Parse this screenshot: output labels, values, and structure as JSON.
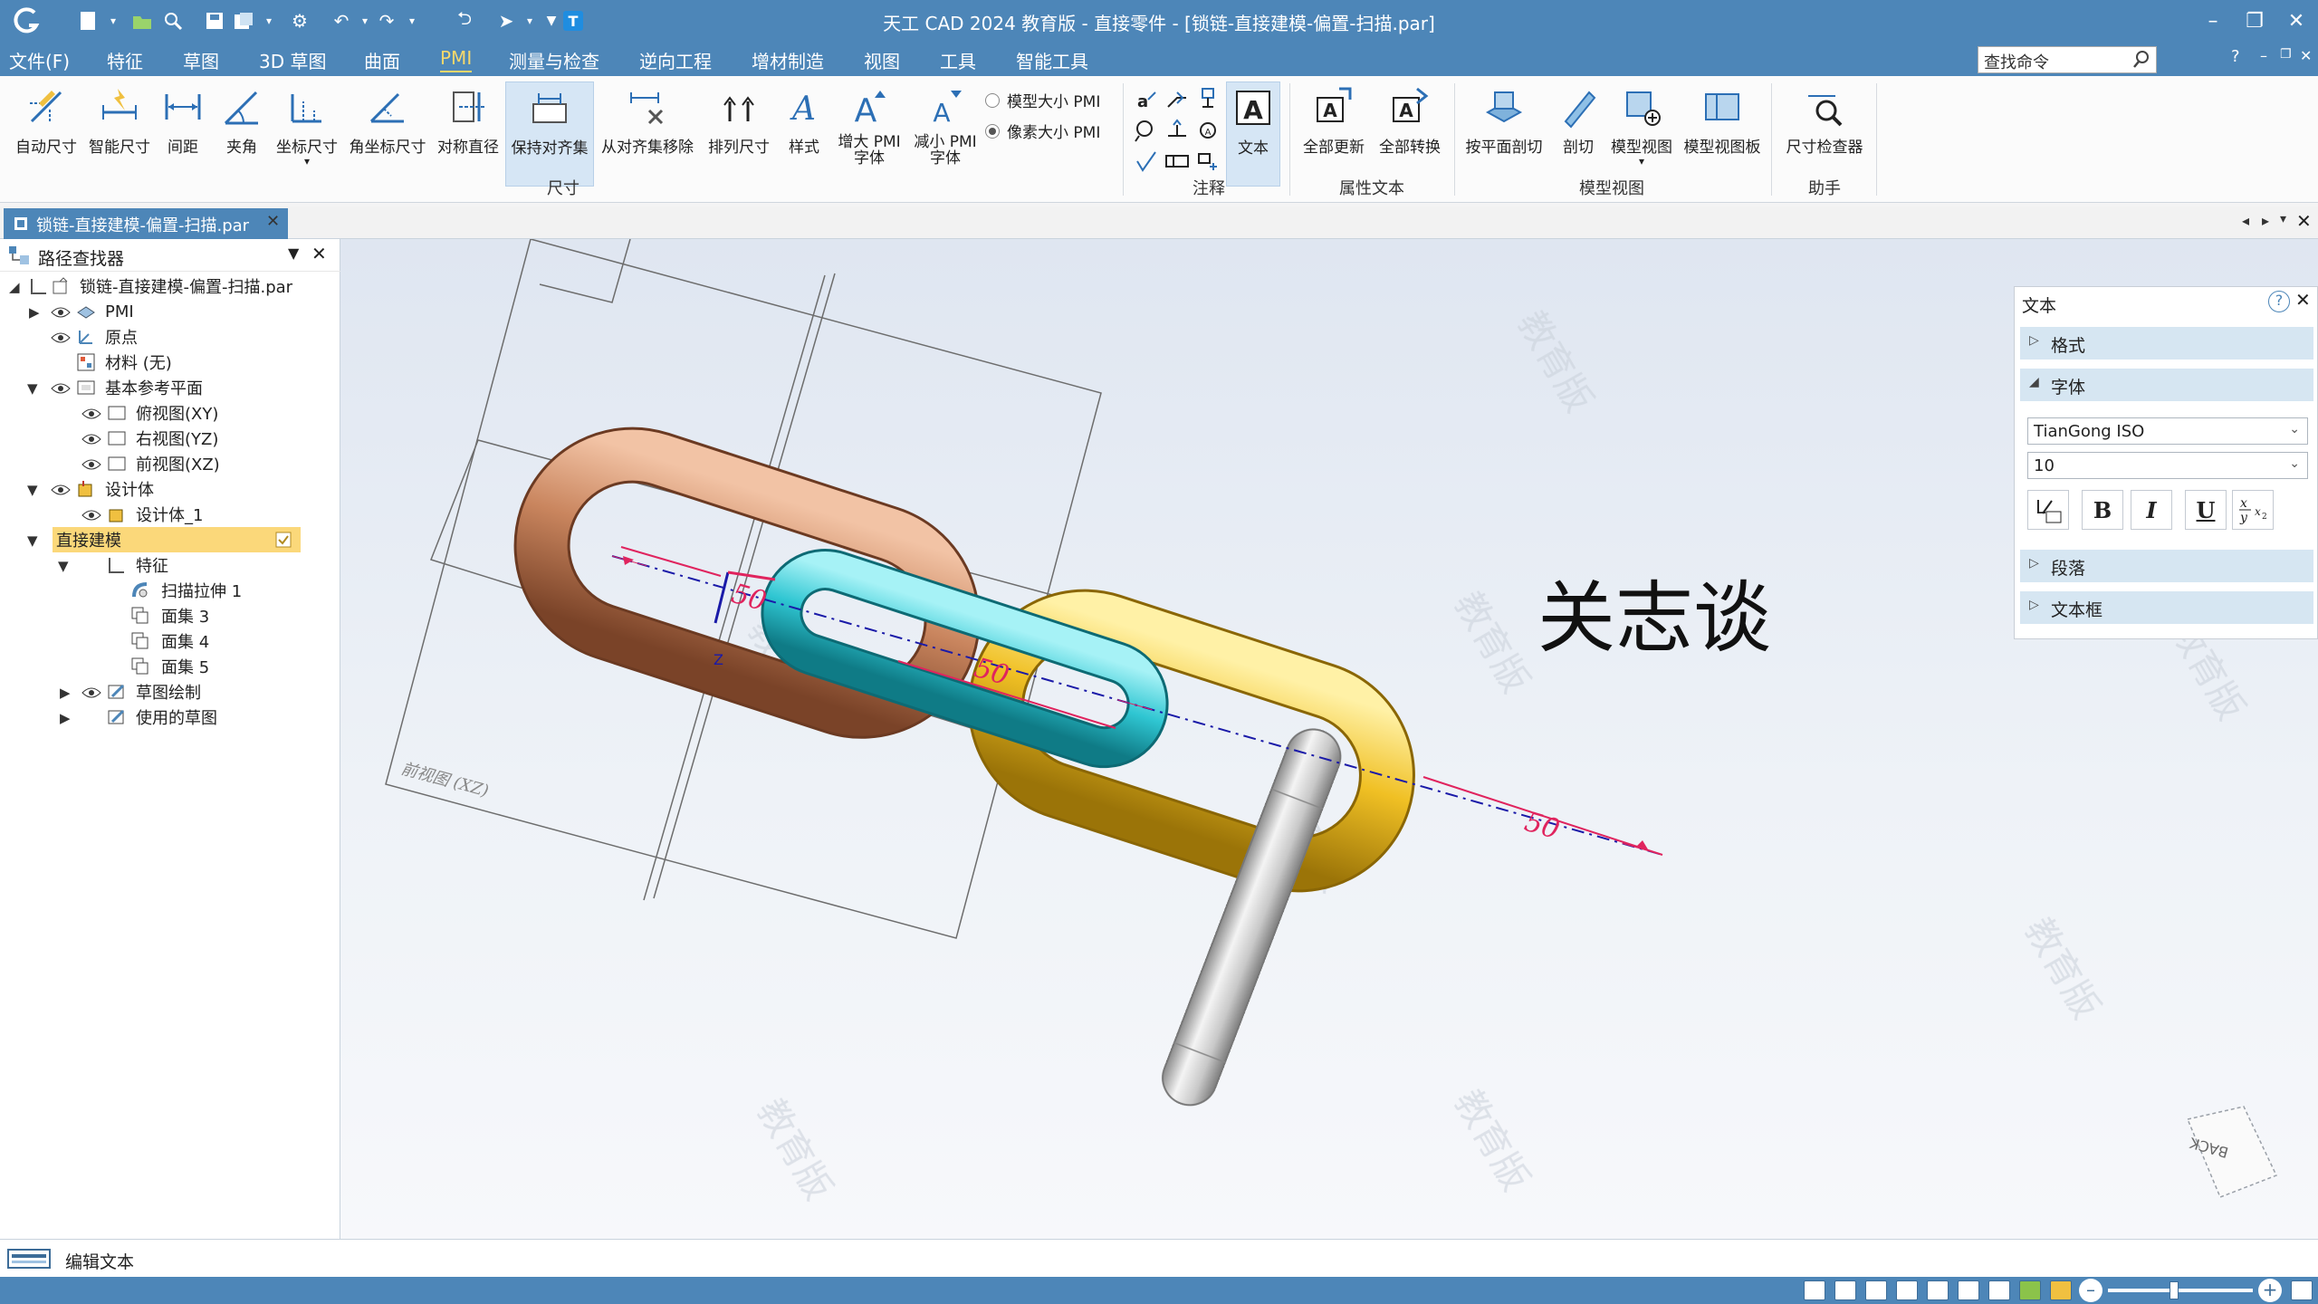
{
  "app": {
    "title": "天工 CAD 2024 教育版 - 直接零件 - [锁链-直接建模-偏置-扫描.par]"
  },
  "menu": [
    "文件(F)",
    "特征",
    "草图",
    "3D 草图",
    "曲面",
    "PMI",
    "测量与检查",
    "逆向工程",
    "增材制造",
    "视图",
    "工具",
    "智能工具"
  ],
  "search": {
    "value": "查找命令"
  },
  "help": {
    "label": "?"
  },
  "ribbon": {
    "dimension": [
      "自动尺寸",
      "智能尺寸",
      "间距",
      "夹角",
      "坐标尺寸",
      "角坐标尺寸",
      "对称直径",
      "保持对齐集",
      "从对齐集移除",
      "排列尺寸",
      "样式"
    ],
    "pmi_font_up": [
      "增大 PMI",
      "字体"
    ],
    "pmi_font_down": [
      "减小 PMI",
      "字体"
    ],
    "model_size": "模型大小 PMI",
    "pixel_size": "像素大小 PMI",
    "text_btn": "文本",
    "attr": [
      "全部更新",
      "全部转换"
    ],
    "model_view": [
      "按平面剖切",
      "剖切",
      "模型视图",
      "模型视图板"
    ],
    "helper": [
      "尺寸检查器"
    ],
    "groups": {
      "dimension": "尺寸",
      "annotation": "注释",
      "attr_text": "属性文本",
      "model_view": "模型视图",
      "helper": "助手"
    }
  },
  "tab": {
    "label": "锁链-直接建模-偏置-扫描.par"
  },
  "tree": {
    "header": "路径查找器",
    "root": "锁链-直接建模-偏置-扫描.par",
    "nodes": [
      "PMI",
      "原点",
      "材料 (无)",
      "基本参考平面",
      "俯视图(XY)",
      "右视图(YZ)",
      "前视图(XZ)",
      "设计体",
      "设计体_1",
      "直接建模",
      "特征",
      "扫描拉伸 1",
      "面集 3",
      "面集 4",
      "面集 5",
      "草图绘制",
      "使用的草图"
    ]
  },
  "viewport": {
    "big_text": "关志谈",
    "dimension": "50",
    "plane_label": "前视图 (XZ)",
    "watermark": "教育版",
    "axis_z": "Z",
    "cube_face": "BACK"
  },
  "text_panel": {
    "title": "文本",
    "sections": [
      "格式",
      "字体",
      "段落",
      "文本框"
    ],
    "font_value": "TianGong ISO",
    "size_value": "10",
    "fmt": {
      "bold": "B",
      "italic": "I",
      "underline": "U"
    }
  },
  "status": {
    "text": "编辑文本"
  },
  "colors": {
    "accent": "#4d86b8",
    "highlight": "#fbd87a",
    "panel_section": "#d6e6f2",
    "dim": "#e0245e"
  }
}
